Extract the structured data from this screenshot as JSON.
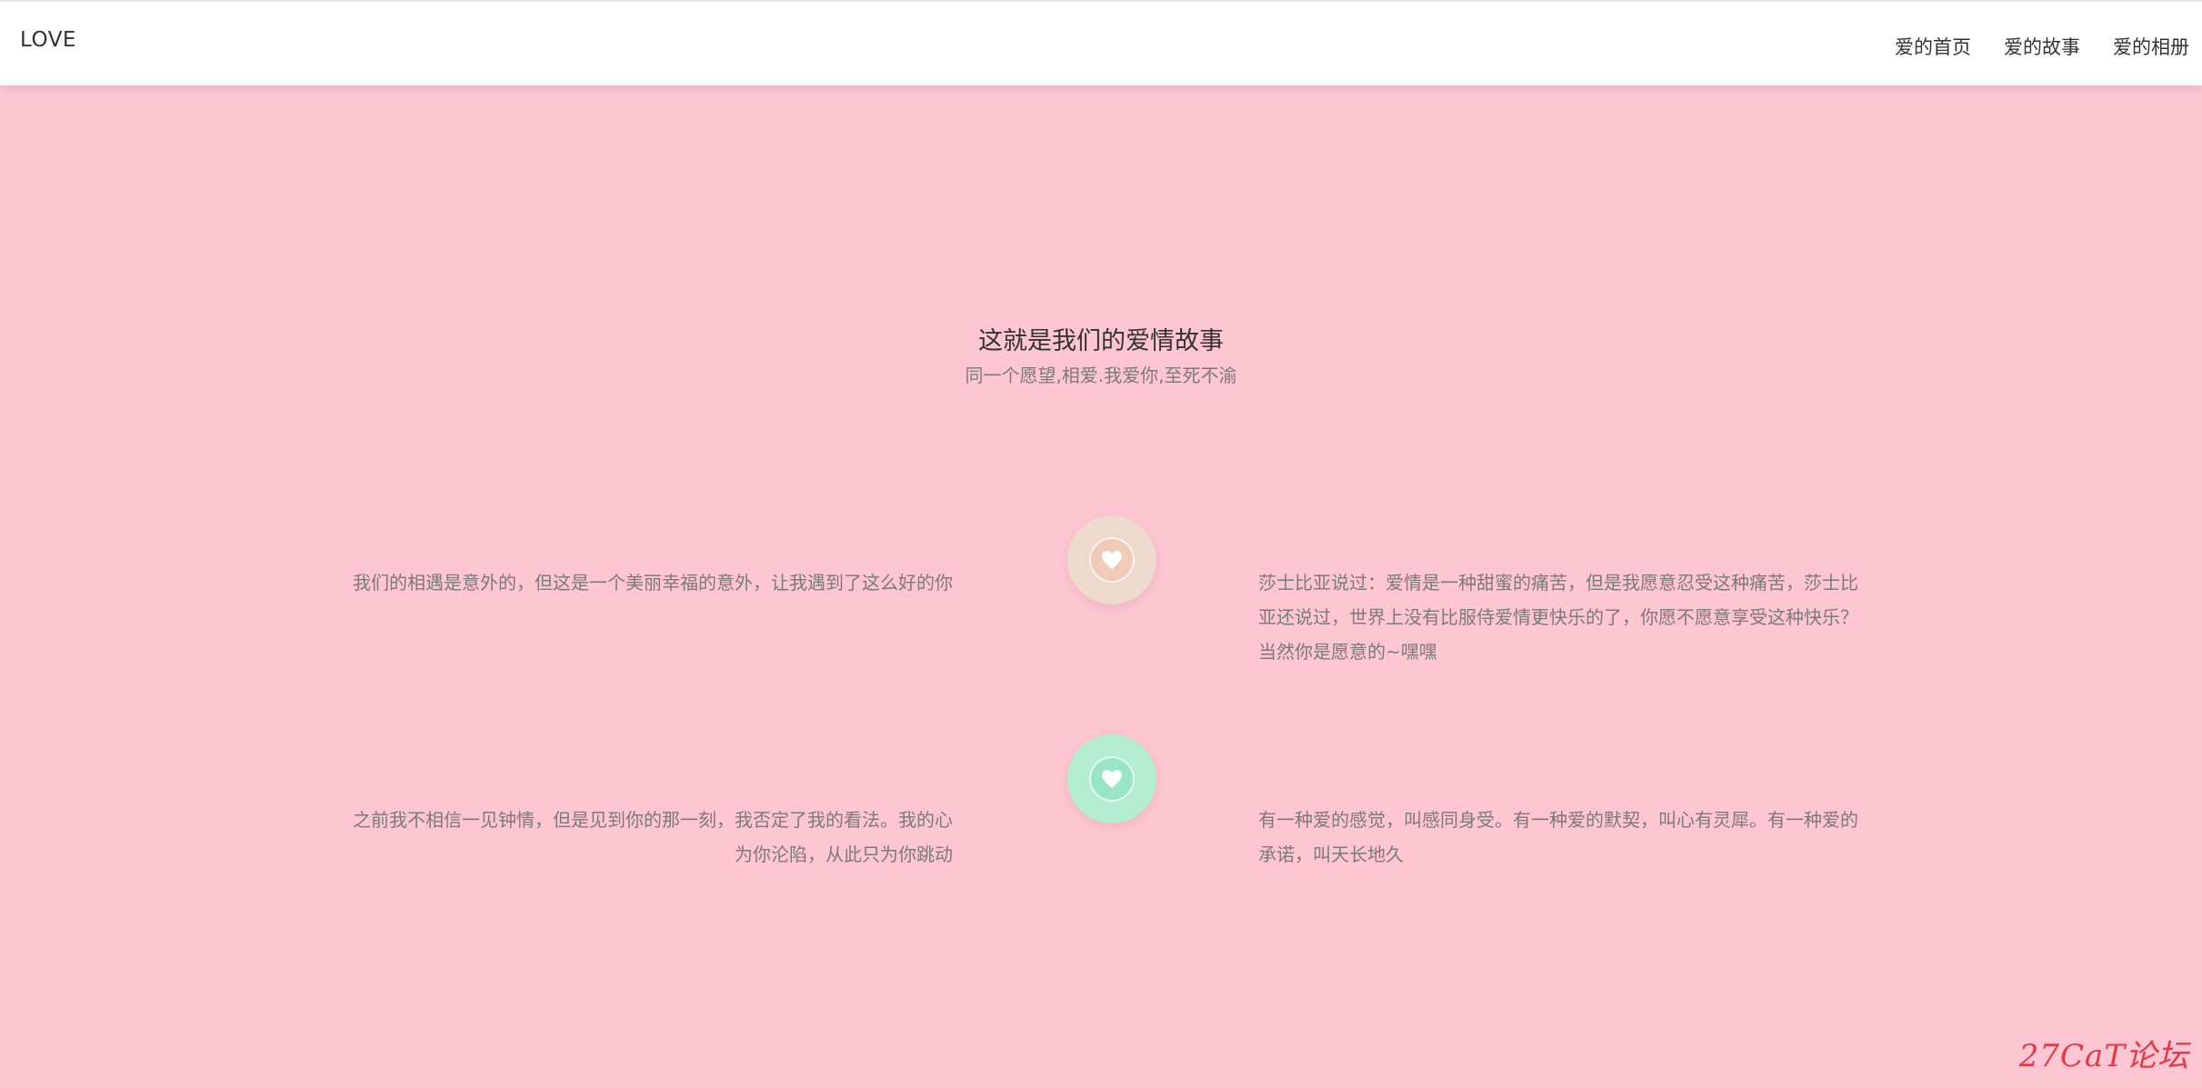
{
  "header": {
    "brand": "LOVE",
    "nav": [
      {
        "label": "爱的首页"
      },
      {
        "label": "爱的故事"
      },
      {
        "label": "爱的相册"
      }
    ]
  },
  "section": {
    "title": "这就是我们的爱情故事",
    "subtitle": "同一个愿望,相爱.我爱你,至死不渝"
  },
  "stories": [
    {
      "left_text": "我们的相遇是意外的，但这是一个美丽幸福的意外，让我遇到了这么好的你",
      "right_text": "莎士比亚说过：爱情是一种甜蜜的痛苦，但是我愿意忍受这种痛苦，莎士比亚还说过，世界上没有比服侍爱情更快乐的了，你愿不愿意享受这种快乐？当然你是愿意的~嘿嘿",
      "icon": "heart-icon",
      "badge_color": "#eddacc",
      "inner_color": "#f0cbb8"
    },
    {
      "left_text": "之前我不相信一见钟情，但是见到你的那一刻，我否定了我的看法。我的心为你沦陷，从此只为你跳动",
      "right_text": "有一种爱的感觉，叫感同身受。有一种爱的默契，叫心有灵犀。有一种爱的承诺，叫天长地久",
      "icon": "heart-icon",
      "badge_color": "#b2edd4",
      "inner_color": "#98e6c6"
    }
  ],
  "watermark": "27CaT论坛"
}
